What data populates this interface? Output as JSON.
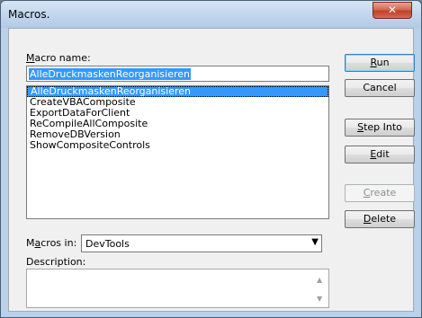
{
  "window": {
    "title": "Macros."
  },
  "labels": {
    "macro_name_underline": "M",
    "macro_name_rest": "acro name:",
    "macros_in_underline": "a",
    "macros_in_pre": "M",
    "macros_in_post": "cros in:",
    "description": "Description:"
  },
  "macro_name_value": "AlleDruckmaskenReorganisieren",
  "macros": [
    "AlleDruckmaskenReorganisieren",
    "CreateVBAComposite",
    "ExportDataForClient",
    "ReCompileAllComposite",
    "RemoveDBVersion",
    "ShowCompositeControls"
  ],
  "selected_index": 0,
  "buttons": {
    "run": {
      "pre": "",
      "u": "R",
      "post": "un"
    },
    "cancel": {
      "pre": "",
      "u": "",
      "post": "Cancel"
    },
    "step_into": {
      "pre": "",
      "u": "S",
      "post": "tep Into"
    },
    "edit": {
      "pre": "",
      "u": "E",
      "post": "dit"
    },
    "create": {
      "pre": "",
      "u": "C",
      "post": "reate"
    },
    "delete": {
      "pre": "",
      "u": "D",
      "post": "elete"
    }
  },
  "macros_in_value": "DevTools",
  "icons": {
    "close": "close-icon",
    "dropdown": "chevron-down-icon"
  }
}
